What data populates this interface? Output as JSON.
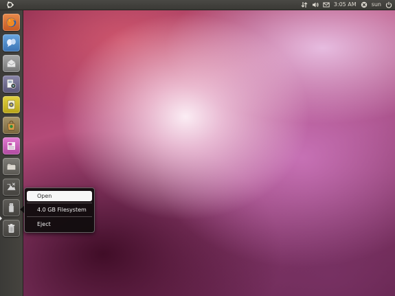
{
  "top_panel": {
    "clock": "3:05 AM",
    "user": "sun"
  },
  "launcher": {
    "items": [
      {
        "name": "firefox-launcher-item",
        "icon": "firefox-icon",
        "color": "#d86a2a"
      },
      {
        "name": "empathy-launcher-item",
        "icon": "chat-bubbles-icon",
        "color": "#4a86c6"
      },
      {
        "name": "evolution-launcher-item",
        "icon": "mail-envelope-icon",
        "color": "#8a8a8a"
      },
      {
        "name": "shotwell-launcher-item",
        "icon": "photo-viewer-icon",
        "color": "#6e6a8e"
      },
      {
        "name": "rhythmbox-launcher-item",
        "icon": "music-player-icon",
        "color": "#c8b820"
      },
      {
        "name": "software-center-launcher-item",
        "icon": "shopping-bag-icon",
        "color": "#8d7a55"
      },
      {
        "name": "libreoffice-launcher-item",
        "icon": "office-document-icon",
        "color": "#c85ab0"
      },
      {
        "name": "files-launcher-item",
        "icon": "folder-icon",
        "color": "#6a6863"
      },
      {
        "name": "workspaces-launcher-item",
        "icon": "workspace-switcher-icon",
        "color": "#55534f"
      },
      {
        "name": "usb-drive-launcher-item",
        "icon": "usb-drive-icon",
        "color": "#55534f"
      },
      {
        "name": "trash-launcher-item",
        "icon": "trash-icon",
        "color": "#55534f"
      }
    ]
  },
  "quicklist": {
    "items": [
      "Open",
      "4.0 GB Filesystem",
      "Eject"
    ]
  },
  "colors": {
    "panel": "#3c3b37",
    "launcher": "#42403c",
    "accent_orange": "#e95420",
    "menu_bg": "#0e0c0c",
    "menu_selected": "#f7f7f7"
  }
}
